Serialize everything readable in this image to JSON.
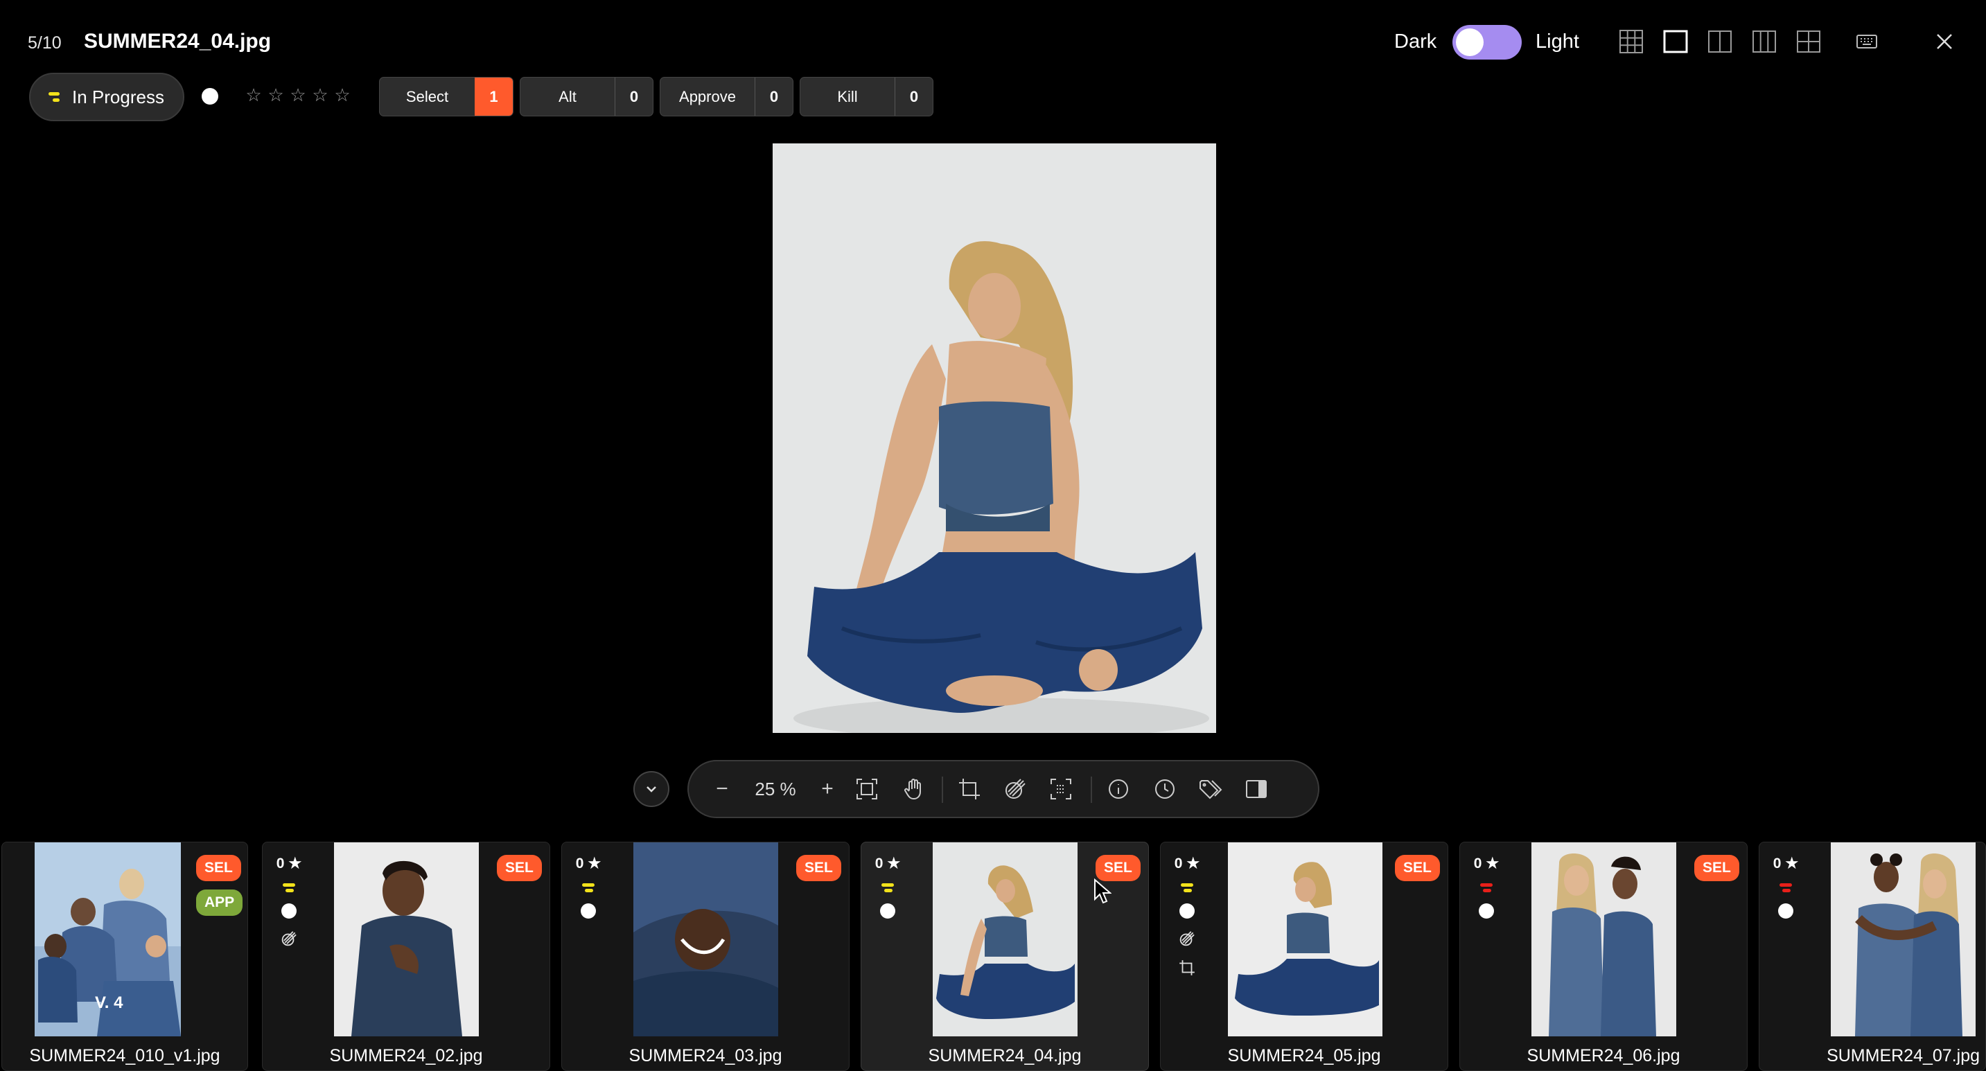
{
  "header": {
    "counter": "5/10",
    "filename": "SUMMER24_04.jpg",
    "theme": {
      "dark_label": "Dark",
      "light_label": "Light",
      "mode": "dark"
    },
    "view_icons": [
      "grid-view-icon",
      "single-view-icon",
      "split-two-view-icon",
      "split-three-view-icon",
      "quad-view-icon",
      "keyboard-icon",
      "close-icon"
    ]
  },
  "actions": {
    "status_label": "In Progress",
    "status_color": "#f2e21b",
    "rating_stars": [
      "☆",
      "☆",
      "☆",
      "☆",
      "☆"
    ],
    "votes": [
      {
        "label": "Select",
        "count": "1",
        "active": true
      },
      {
        "label": "Alt",
        "count": "0",
        "active": false
      },
      {
        "label": "Approve",
        "count": "0",
        "active": false
      },
      {
        "label": "Kill",
        "count": "0",
        "active": false
      }
    ]
  },
  "toolbar": {
    "zoom_minus": "−",
    "zoom_value": "25 %",
    "zoom_plus": "+",
    "icons": [
      "fit-screen-icon",
      "hand-pan-icon",
      "crop-icon",
      "retouch-icon",
      "focus-frame-icon",
      "info-icon",
      "history-icon",
      "tags-icon",
      "compare-panel-icon"
    ]
  },
  "colors": {
    "accent": "#ff5a2c",
    "approve": "#7ea83a",
    "toggle": "#a58cf0",
    "status_yellow": "#f2e21b",
    "status_red": "#e8201a"
  },
  "filmstrip": [
    {
      "name": "SUMMER24_010_v1.jpg",
      "stars": "",
      "status": "",
      "badges": [
        "SEL",
        "APP"
      ],
      "version": "V. 4"
    },
    {
      "name": "SUMMER24_02.jpg",
      "stars": "0",
      "status": "yellow",
      "badges": [
        "SEL"
      ],
      "extras": [
        "retouch"
      ]
    },
    {
      "name": "SUMMER24_03.jpg",
      "stars": "0",
      "status": "yellow",
      "badges": [
        "SEL"
      ]
    },
    {
      "name": "SUMMER24_04.jpg",
      "stars": "0",
      "status": "yellow",
      "badges": [
        "SEL"
      ],
      "current": true
    },
    {
      "name": "SUMMER24_05.jpg",
      "stars": "0",
      "status": "yellow",
      "badges": [
        "SEL"
      ],
      "extras": [
        "retouch",
        "crop"
      ]
    },
    {
      "name": "SUMMER24_06.jpg",
      "stars": "0",
      "status": "red",
      "badges": [
        "SEL"
      ]
    },
    {
      "name": "SUMMER24_07.jpg",
      "stars": "0",
      "status": "red",
      "badges": []
    }
  ]
}
